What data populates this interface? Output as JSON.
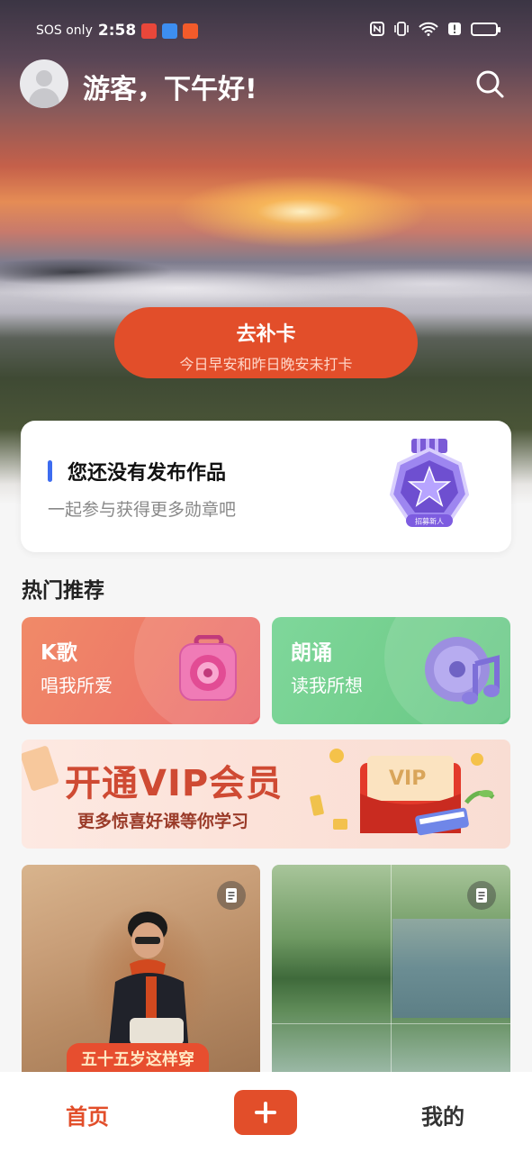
{
  "status_bar": {
    "carrier": "SOS only",
    "time": "2:58",
    "app_icon_colors": [
      "#e8473a",
      "#3d8ef0",
      "#f25b2a"
    ],
    "right_icons": [
      "nfc-icon",
      "vibrate-icon",
      "wifi-icon",
      "alert-icon",
      "battery-icon"
    ]
  },
  "header": {
    "greeting": "游客，下午好!",
    "avatar_icon": "default-avatar-icon",
    "search_icon": "search-icon"
  },
  "checkin": {
    "title": "去补卡",
    "subtitle": "今日早安和昨日晚安未打卡"
  },
  "works_card": {
    "title": "您还没有发布作品",
    "subtitle": "一起参与获得更多勋章吧",
    "medal_label": "招募新人"
  },
  "section": {
    "title": "热门推荐"
  },
  "categories": [
    {
      "name": "K歌",
      "desc": "唱我所爱",
      "icon": "speaker-icon"
    },
    {
      "name": "朗诵",
      "desc": "读我所想",
      "icon": "music-disc-icon"
    }
  ],
  "vip_banner": {
    "title": "开通VIP会员",
    "subtitle": "更多惊喜好课等你学习",
    "card_text": "VIP"
  },
  "posts": [
    {
      "caption": "五十五岁这样穿",
      "icon": "document-icon"
    },
    {
      "caption": "",
      "icon": "document-icon"
    }
  ],
  "bottom_nav": {
    "home": "首页",
    "add": "+",
    "mine": "我的"
  },
  "colors": {
    "accent": "#e24e2a",
    "blue_bar": "#3d6cf0",
    "ksong": "#ee7b68",
    "recite": "#74cf8e"
  }
}
